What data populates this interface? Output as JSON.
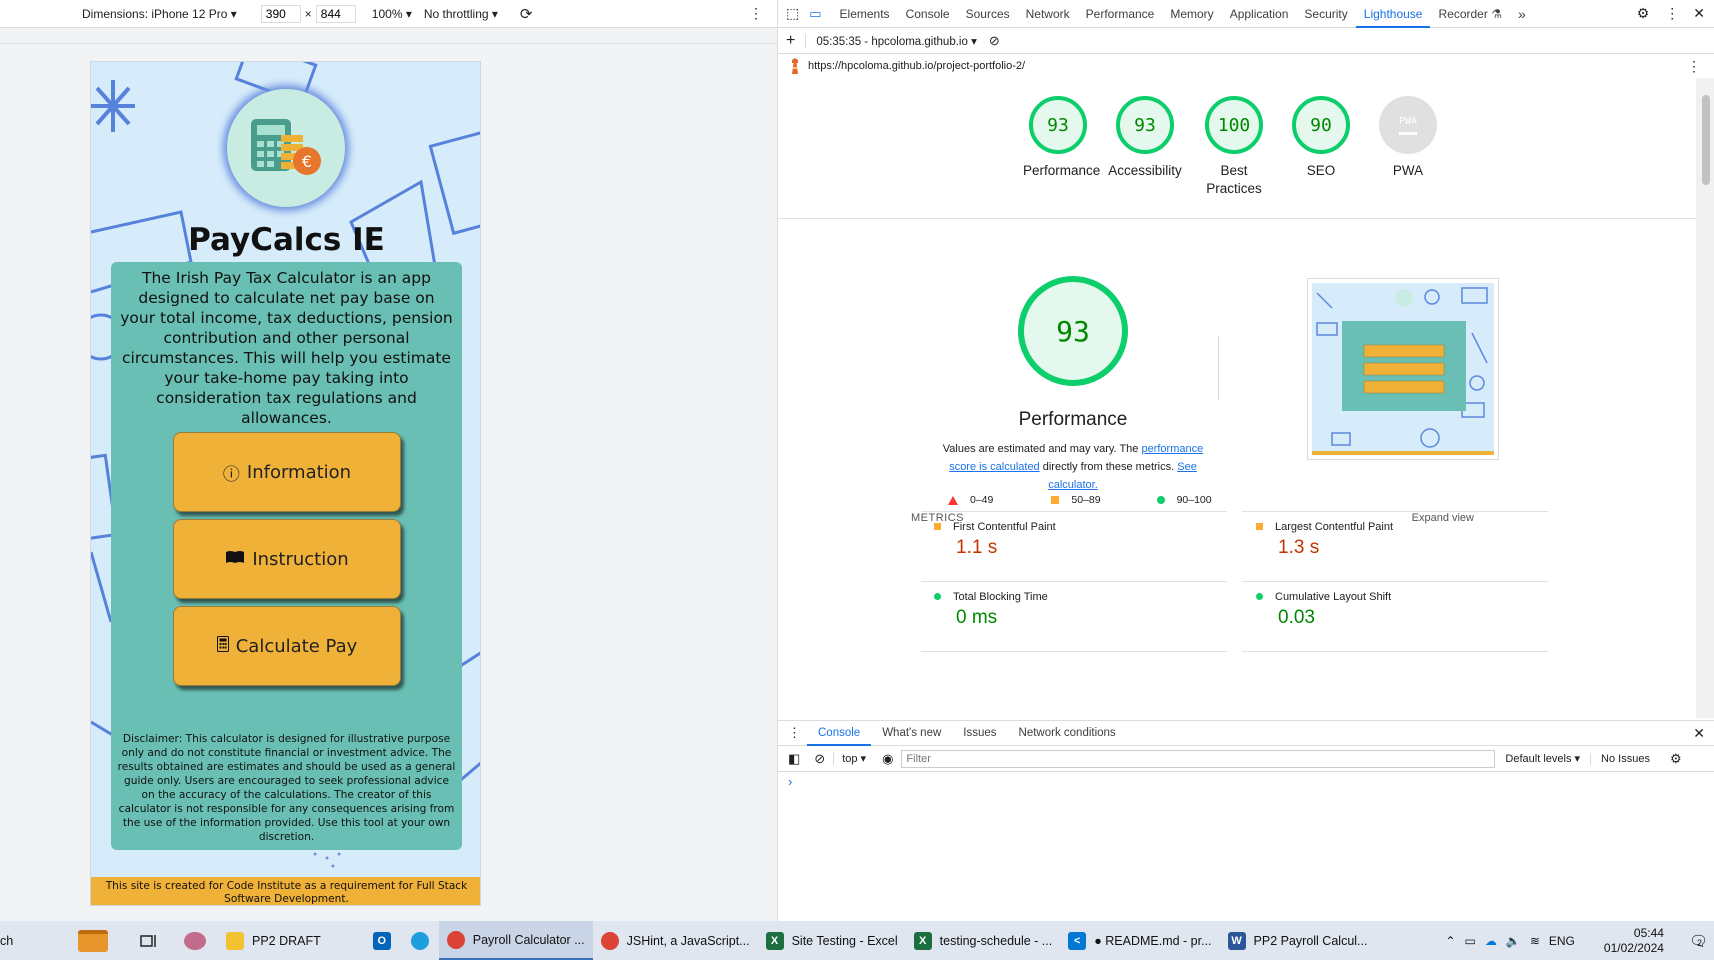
{
  "device_toolbar": {
    "dimensions_label": "Dimensions: iPhone 12 Pro",
    "width": "390",
    "times": "×",
    "height": "844",
    "zoom": "100%",
    "throttling": "No throttling"
  },
  "site": {
    "title": "PayCalcs IE",
    "intro": "The Irish Pay Tax Calculator is an app designed to calculate net pay base on your total income, tax deductions, pension contribution and other personal circumstances. This will help you estimate your take-home pay taking into consideration tax regulations and allowances.",
    "buttons": {
      "information": "Information",
      "instruction": "Instruction",
      "calculate": "Calculate Pay"
    },
    "disclaimer": "Disclaimer: This calculator is designed for illustrative purpose only and do not constitute financial or investment advice. The results obtained are estimates and should be used as a general guide only. Users are encouraged to seek professional advice on the accuracy of the calculations. The creator of this calculator is not responsible for any consequences arising from the use of the information provided. Use this tool at your own discretion.",
    "footer": "This site is created for Code Institute as a requirement for Full Stack Software Development."
  },
  "devtools": {
    "tabs": [
      "Elements",
      "Console",
      "Sources",
      "Network",
      "Performance",
      "Memory",
      "Application",
      "Security",
      "Lighthouse",
      "Recorder"
    ],
    "more": "»",
    "lighthouse_bar": {
      "add": "+",
      "report_selector": "05:35:35 - hpcoloma.github.io"
    },
    "url": "https://hpcoloma.github.io/project-portfolio-2/",
    "scores": [
      {
        "label": "Performance",
        "value": "93"
      },
      {
        "label": "Accessibility",
        "value": "93"
      },
      {
        "label": "Best Practices",
        "value": "100"
      },
      {
        "label": "SEO",
        "value": "90"
      },
      {
        "label": "PWA",
        "value": "PWA"
      }
    ],
    "performance": {
      "score": "93",
      "title": "Performance",
      "note_prefix": "Values are estimated and may vary. The",
      "note_link": "performance score is calculated",
      "note_mid": "directly from these metrics.",
      "note_link2": "See calculator.",
      "legend": [
        {
          "range": "0–49",
          "color": "#ff3333"
        },
        {
          "range": "50–89",
          "color": "#ffaa33"
        },
        {
          "range": "90–100",
          "color": "#0cce6b"
        }
      ],
      "metrics_heading": "METRICS",
      "expand": "Expand view",
      "metrics": [
        {
          "name": "First Contentful Paint",
          "value": "1.1 s",
          "status": "average"
        },
        {
          "name": "Largest Contentful Paint",
          "value": "1.3 s",
          "status": "average"
        },
        {
          "name": "Total Blocking Time",
          "value": "0 ms",
          "status": "pass"
        },
        {
          "name": "Cumulative Layout Shift",
          "value": "0.03",
          "status": "pass"
        },
        {
          "name": "Speed Index",
          "value": "",
          "status": "average"
        }
      ]
    },
    "drawer": {
      "tabs": [
        "Console",
        "What's new",
        "Issues",
        "Network conditions"
      ],
      "context": "top",
      "filter_placeholder": "Filter",
      "levels": "Default levels",
      "issues": "No Issues",
      "prompt": "›"
    }
  },
  "taskbar": {
    "search_fragment": "ch",
    "items": [
      {
        "label": "PP2 DRAFT",
        "icon": "folder-icon",
        "color": "#f2c230"
      },
      {
        "label": "Payroll Calculator ...",
        "icon": "chrome-icon",
        "color": "#db4437"
      },
      {
        "label": "JSHint, a JavaScript...",
        "icon": "chrome-icon",
        "color": "#db4437"
      },
      {
        "label": "Site Testing - Excel",
        "icon": "excel-icon",
        "color": "#1d6f42"
      },
      {
        "label": "testing-schedule - ...",
        "icon": "excel-icon",
        "color": "#1d6f42"
      },
      {
        "label": "● README.md - pr...",
        "icon": "vscode-icon",
        "color": "#0078d4"
      },
      {
        "label": "PP2 Payroll Calcul...",
        "icon": "word-icon",
        "color": "#2b579a"
      }
    ],
    "lang": "ENG",
    "time": "05:44",
    "date": "01/02/2024",
    "notifications": "2"
  }
}
